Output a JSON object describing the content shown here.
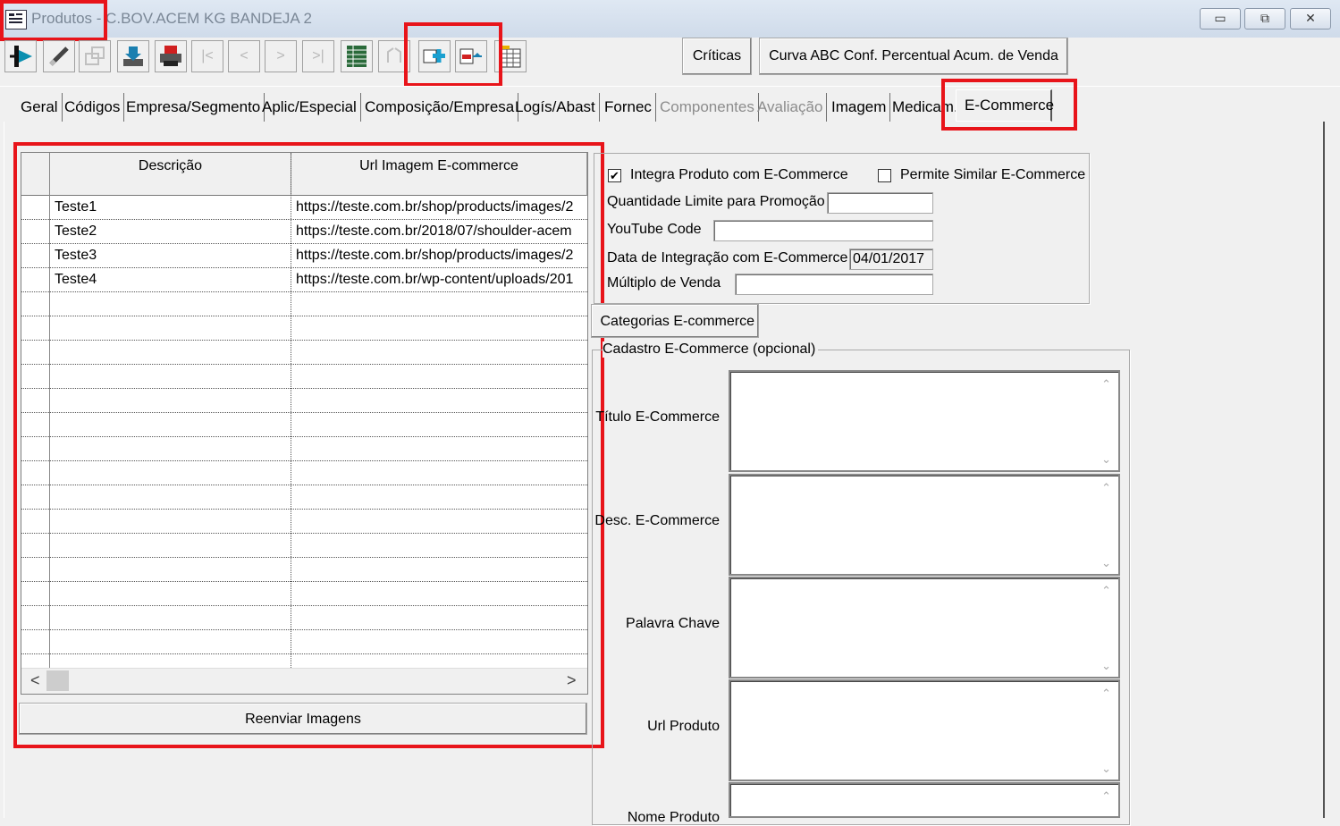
{
  "window": {
    "title": "Produtos - C.BOV.ACEM KG BANDEJA 2",
    "minimize": "▭",
    "restore": "⧉",
    "close": "✕"
  },
  "toolbar": {
    "icons": [
      "exit-icon",
      "edit-pencil-icon",
      "disabled-icon",
      "save-icon",
      "print-icon",
      "first-record-icon",
      "prev-record-icon",
      "next-record-icon",
      "last-record-icon",
      "table-icon",
      "disabled-refresh-icon",
      "add-record-icon",
      "remove-record-icon",
      "grid-calendar-icon"
    ],
    "criticas": "Críticas",
    "curva_abc": "Curva ABC Conf. Percentual Acum. de Venda"
  },
  "tabs": [
    {
      "label": "Geral",
      "enabled": true
    },
    {
      "label": "Códigos",
      "enabled": true
    },
    {
      "label": "Empresa/Segmento",
      "enabled": true
    },
    {
      "label": "Aplic/Especial",
      "enabled": true
    },
    {
      "label": "Composição/Empresa",
      "enabled": true
    },
    {
      "label": "Logís/Abast",
      "enabled": true
    },
    {
      "label": "Fornec",
      "enabled": true
    },
    {
      "label": "Componentes",
      "enabled": false
    },
    {
      "label": "Avaliação",
      "enabled": false
    },
    {
      "label": "Imagem",
      "enabled": true
    },
    {
      "label": "Medicam.",
      "enabled": true
    },
    {
      "label": "E-Commerce",
      "enabled": true,
      "active": true
    }
  ],
  "grid": {
    "headers": [
      "Descrição",
      "Url Imagem E-commerce"
    ],
    "rows": [
      [
        "Teste1",
        "https://teste.com.br/shop/products/images/2"
      ],
      [
        "Teste2",
        "https://teste.com.br/2018/07/shoulder-acem"
      ],
      [
        "Teste3",
        "https://teste.com.br/shop/products/images/2"
      ],
      [
        "Teste4",
        "https://teste.com.br/wp-content/uploads/201"
      ]
    ],
    "scroll_left": "<",
    "scroll_right": ">"
  },
  "reenviar_button": "Reenviar Imagens",
  "form": {
    "integra_label": "Integra Produto com E-Commerce",
    "integra_checked": true,
    "permite_label": "Permite Similar E-Commerce",
    "permite_checked": false,
    "qtd_label": "Quantidade Limite para Promoção",
    "qtd_value": "",
    "youtube_label": "YouTube Code",
    "youtube_value": "",
    "data_label": "Data de Integração com E-Commerce",
    "data_value": "04/01/2017",
    "multiplo_label": "Múltiplo de Venda",
    "multiplo_value": ""
  },
  "categorias_button": "Categorias E-commerce",
  "cadastro": {
    "group_label": "Cadastro E-Commerce (opcional)",
    "fields": [
      {
        "label": "Título E-Commerce",
        "value": ""
      },
      {
        "label": "Desc. E-Commerce",
        "value": ""
      },
      {
        "label": "Palavra Chave",
        "value": ""
      },
      {
        "label": "Url Produto",
        "value": ""
      },
      {
        "label": "Nome Produto",
        "value": ""
      }
    ]
  },
  "colors": {
    "highlight": "#e8141a",
    "title_text": "#7a8796"
  }
}
